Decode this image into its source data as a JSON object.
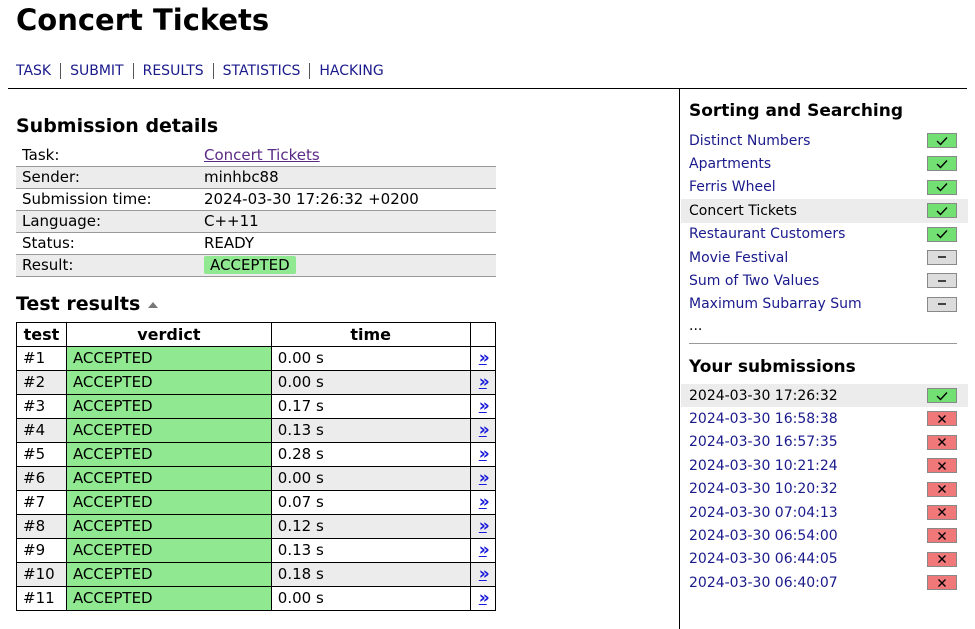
{
  "page": {
    "title": "Concert Tickets"
  },
  "nav": [
    {
      "label": "TASK"
    },
    {
      "label": "SUBMIT"
    },
    {
      "label": "RESULTS"
    },
    {
      "label": "STATISTICS"
    },
    {
      "label": "HACKING"
    }
  ],
  "details": {
    "title": "Submission details",
    "rows": [
      {
        "key": "Task:",
        "value": "Concert Tickets"
      },
      {
        "key": "Sender:",
        "value": "minhbc88"
      },
      {
        "key": "Submission time:",
        "value": "2024-03-30 17:26:32 +0200"
      },
      {
        "key": "Language:",
        "value": "C++11"
      },
      {
        "key": "Status:",
        "value": "READY"
      },
      {
        "key": "Result:",
        "value": "ACCEPTED"
      }
    ]
  },
  "tests": {
    "title": "Test results",
    "headers": {
      "test": "test",
      "verdict": "verdict",
      "time": "time"
    },
    "link_glyph": "»",
    "rows": [
      {
        "num": "#1",
        "verdict": "ACCEPTED",
        "time": "0.00 s"
      },
      {
        "num": "#2",
        "verdict": "ACCEPTED",
        "time": "0.00 s"
      },
      {
        "num": "#3",
        "verdict": "ACCEPTED",
        "time": "0.17 s"
      },
      {
        "num": "#4",
        "verdict": "ACCEPTED",
        "time": "0.13 s"
      },
      {
        "num": "#5",
        "verdict": "ACCEPTED",
        "time": "0.28 s"
      },
      {
        "num": "#6",
        "verdict": "ACCEPTED",
        "time": "0.00 s"
      },
      {
        "num": "#7",
        "verdict": "ACCEPTED",
        "time": "0.07 s"
      },
      {
        "num": "#8",
        "verdict": "ACCEPTED",
        "time": "0.12 s"
      },
      {
        "num": "#9",
        "verdict": "ACCEPTED",
        "time": "0.13 s"
      },
      {
        "num": "#10",
        "verdict": "ACCEPTED",
        "time": "0.18 s"
      },
      {
        "num": "#11",
        "verdict": "ACCEPTED",
        "time": "0.00 s"
      }
    ]
  },
  "sidebar": {
    "section_title": "Sorting and Searching",
    "tasks": [
      {
        "name": "Distinct Numbers",
        "status": "solved",
        "current": false
      },
      {
        "name": "Apartments",
        "status": "solved",
        "current": false
      },
      {
        "name": "Ferris Wheel",
        "status": "solved",
        "current": false
      },
      {
        "name": "Concert Tickets",
        "status": "solved",
        "current": true
      },
      {
        "name": "Restaurant Customers",
        "status": "solved",
        "current": false
      },
      {
        "name": "Movie Festival",
        "status": "unsolved",
        "current": false
      },
      {
        "name": "Sum of Two Values",
        "status": "unsolved",
        "current": false
      },
      {
        "name": "Maximum Subarray Sum",
        "status": "unsolved",
        "current": false
      }
    ],
    "more": "...",
    "submissions_title": "Your submissions",
    "submissions": [
      {
        "time": "2024-03-30 17:26:32",
        "status": "accepted",
        "current": true
      },
      {
        "time": "2024-03-30 16:58:38",
        "status": "rejected",
        "current": false
      },
      {
        "time": "2024-03-30 16:57:35",
        "status": "rejected",
        "current": false
      },
      {
        "time": "2024-03-30 10:21:24",
        "status": "rejected",
        "current": false
      },
      {
        "time": "2024-03-30 10:20:32",
        "status": "rejected",
        "current": false
      },
      {
        "time": "2024-03-30 07:04:13",
        "status": "rejected",
        "current": false
      },
      {
        "time": "2024-03-30 06:54:00",
        "status": "rejected",
        "current": false
      },
      {
        "time": "2024-03-30 06:44:05",
        "status": "rejected",
        "current": false
      },
      {
        "time": "2024-03-30 06:40:07",
        "status": "rejected",
        "current": false
      }
    ]
  },
  "icons": {
    "solved": "check-icon",
    "unsolved": "dash-icon",
    "rejected": "cross-icon"
  },
  "colors": {
    "accepted_green": "#90e890",
    "status_green": "#72e072",
    "status_red": "#f07878",
    "status_gray": "#dcdcdc",
    "link_blue": "#1a1a8c"
  }
}
